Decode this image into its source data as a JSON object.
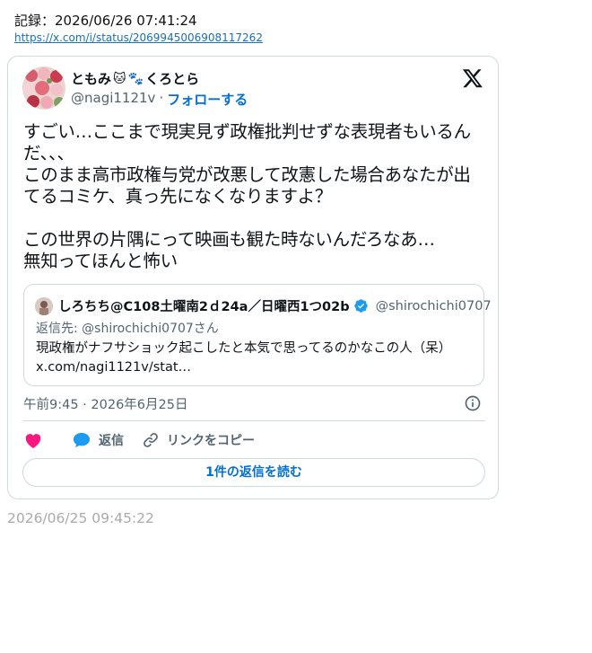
{
  "record": {
    "label": "記録：2026/06/26 07:41:24",
    "url": "https://x.com/i/status/2069945006908117262"
  },
  "tweet": {
    "author_name": "ともみ",
    "author_name_suffix": "くろとら",
    "handle": "@nagi1121v",
    "separator": "·",
    "follow_label": "フォローする",
    "text": "すごい…ここまで現実見ず政権批判せずな表現者もいるんだ、、、\nこのまま高市政権与党が改悪して改憲した場合あなたが出てるコミケ、真っ先になくなりますよ？\n\nこの世界の片隅にって映画も観た時ないんだろなあ…\n無知ってほんと怖い",
    "timestamp": "午前9:45 · 2026年6月25日",
    "quote": {
      "name": "しろちち@C108土曜南2ｄ24a／日曜西1つ02b",
      "handle": "@shirochichi0707",
      "reply_to": "返信先: @shirochichi0707さん",
      "body": "現政権がナフサショック起こしたと本気で思ってるのかなこの人（呆）x.com/nagi1121v/stat…"
    },
    "actions": {
      "reply": "返信",
      "copy_link": "リンクをコピー"
    },
    "read_replies": "1件の返信を読む"
  },
  "footer": {
    "time": "2026/06/25 09:45:22"
  },
  "colors": {
    "accent": "#006fd6",
    "like": "#f91880",
    "reply": "#1d9bf0",
    "border": "#cfd9de",
    "muted": "#536471"
  }
}
